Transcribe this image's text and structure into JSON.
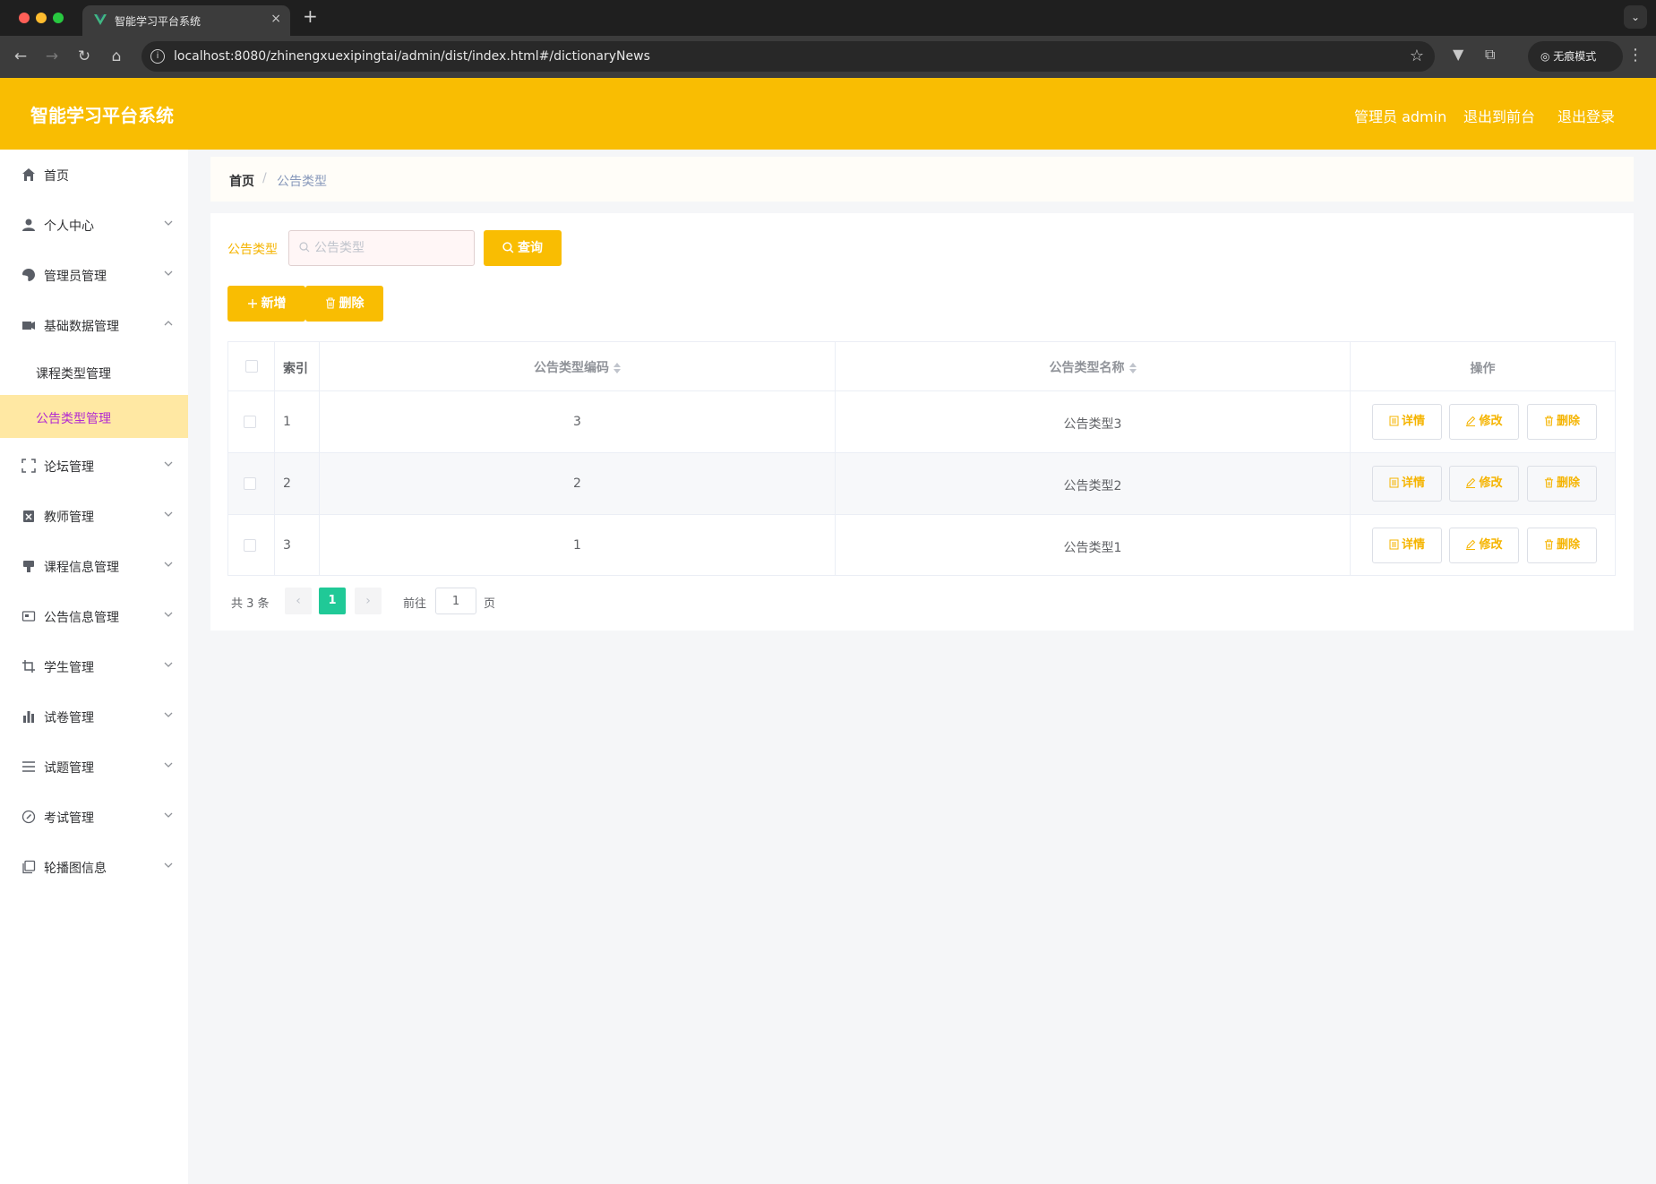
{
  "browser": {
    "tab_title": "智能学习平台系统",
    "tab_close": "×",
    "new_tab": "+",
    "url": "localhost:8080/zhinengxuexipingtai/admin/dist/index.html#/dictionaryNews",
    "incognito_label": "无痕模式"
  },
  "header": {
    "title": "智能学习平台系统",
    "user_label": "管理员 admin",
    "to_front_label": "退出到前台",
    "logout_label": "退出登录"
  },
  "sidebar": {
    "items": [
      {
        "label": "首页",
        "icon": "home-icon",
        "expandable": false
      },
      {
        "label": "个人中心",
        "icon": "user-icon",
        "expandable": true
      },
      {
        "label": "管理员管理",
        "icon": "admin-icon",
        "expandable": true
      },
      {
        "label": "基础数据管理",
        "icon": "data-icon",
        "expandable": true,
        "expanded": true,
        "children": [
          {
            "label": "课程类型管理",
            "active": false
          },
          {
            "label": "公告类型管理",
            "active": true
          }
        ]
      },
      {
        "label": "论坛管理",
        "icon": "forum-icon",
        "expandable": true
      },
      {
        "label": "教师管理",
        "icon": "teacher-icon",
        "expandable": true
      },
      {
        "label": "课程信息管理",
        "icon": "course-icon",
        "expandable": true
      },
      {
        "label": "公告信息管理",
        "icon": "notice-icon",
        "expandable": true
      },
      {
        "label": "学生管理",
        "icon": "student-icon",
        "expandable": true
      },
      {
        "label": "试卷管理",
        "icon": "paper-icon",
        "expandable": true
      },
      {
        "label": "试题管理",
        "icon": "question-icon",
        "expandable": true
      },
      {
        "label": "考试管理",
        "icon": "exam-icon",
        "expandable": true
      },
      {
        "label": "轮播图信息",
        "icon": "carousel-icon",
        "expandable": true
      }
    ]
  },
  "breadcrumb": {
    "home": "首页",
    "separator": "/",
    "current": "公告类型"
  },
  "search": {
    "label": "公告类型",
    "placeholder": "公告类型",
    "value": "",
    "button_label": "查询"
  },
  "actions": {
    "add_label": "新增",
    "delete_label": "删除"
  },
  "table": {
    "columns": {
      "index": "索引",
      "code": "公告类型编码",
      "name": "公告类型名称",
      "ops": "操作"
    },
    "rows": [
      {
        "index": "1",
        "code": "3",
        "name": "公告类型3"
      },
      {
        "index": "2",
        "code": "2",
        "name": "公告类型2"
      },
      {
        "index": "3",
        "code": "1",
        "name": "公告类型1"
      }
    ],
    "row_buttons": {
      "detail": "详情",
      "edit": "修改",
      "delete": "删除"
    }
  },
  "pagination": {
    "total_text": "共 3 条",
    "prev": "‹",
    "next": "›",
    "current_page": "1",
    "goto_label": "前往",
    "goto_value": "1",
    "page_unit": "页"
  },
  "colors": {
    "accent": "#f9bd02",
    "active_submenu_bg": "#ffe8a3",
    "active_submenu_text": "#b32bd1",
    "pager_active": "#20c997"
  }
}
